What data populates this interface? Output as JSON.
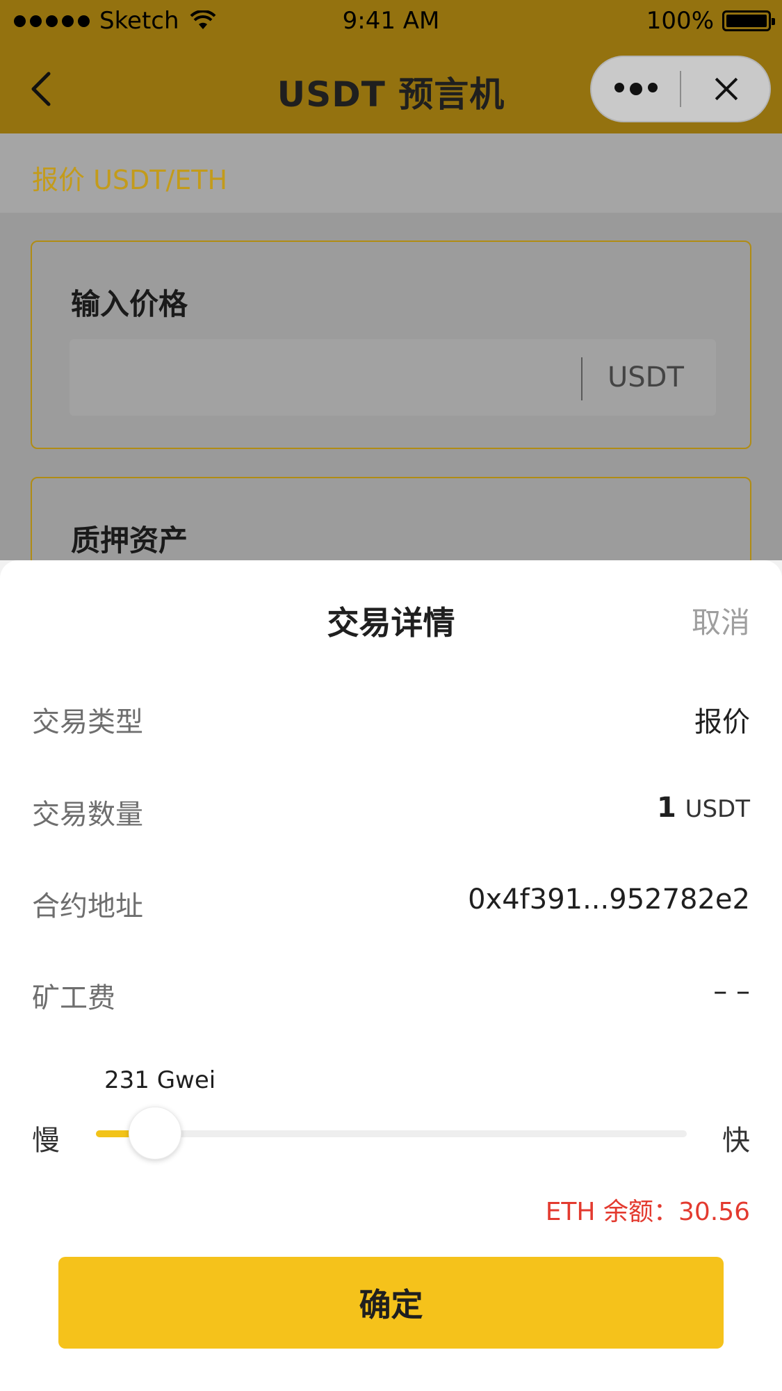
{
  "status_bar": {
    "carrier": "Sketch",
    "time": "9:41 AM",
    "battery": "100%"
  },
  "nav": {
    "title": "USDT 预言机"
  },
  "subheader": {
    "pair": "报价 USDT/ETH"
  },
  "price_card": {
    "title": "输入价格",
    "input_value": "",
    "unit": "USDT"
  },
  "collateral_card": {
    "title": "质押资产"
  },
  "sheet": {
    "title": "交易详情",
    "cancel_label": "取消",
    "rows": [
      {
        "label": "交易类型",
        "value": "报价"
      },
      {
        "label": "交易数量",
        "amount": "1",
        "unit": "USDT"
      },
      {
        "label": "合约地址",
        "value": "0x4f391...952782e2"
      },
      {
        "label": "矿工费",
        "value": "– –"
      }
    ],
    "gas": {
      "value_label": "231 Gwei",
      "slow_label": "慢",
      "fast_label": "快",
      "level": 0.1
    },
    "balance": "ETH 余额：30.56",
    "confirm_label": "确定"
  },
  "colors": {
    "accent": "#f5c21b",
    "warning": "#e33a2f"
  }
}
